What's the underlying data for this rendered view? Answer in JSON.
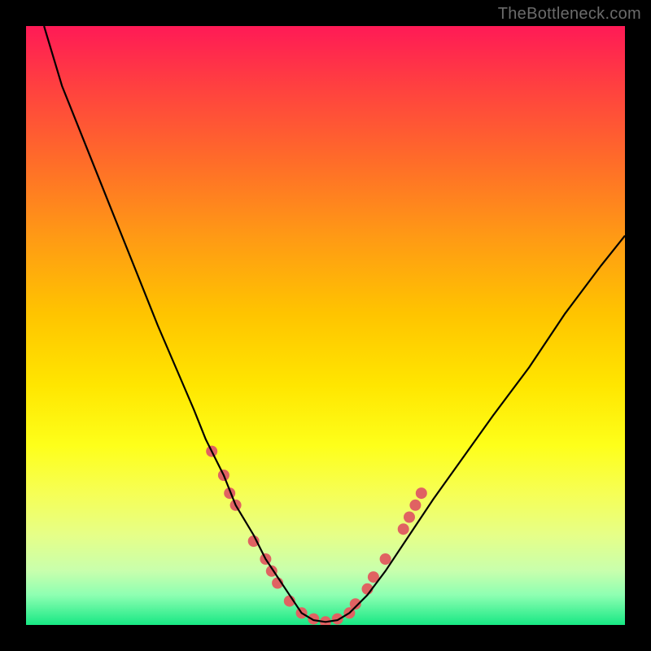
{
  "watermark": "TheBottleneck.com",
  "chart_data": {
    "type": "line",
    "title": "",
    "xlabel": "",
    "ylabel": "",
    "xlim": [
      0,
      100
    ],
    "ylim": [
      0,
      100
    ],
    "series": [
      {
        "name": "curve-left",
        "x": [
          3,
          6,
          10,
          14,
          18,
          22,
          25,
          28,
          30,
          33,
          35,
          38,
          40,
          42,
          44,
          46
        ],
        "values": [
          100,
          90,
          80,
          70,
          60,
          50,
          43,
          36,
          31,
          25,
          20,
          15,
          11,
          8,
          5,
          2
        ]
      },
      {
        "name": "curve-bottom",
        "x": [
          46,
          48,
          50,
          52,
          54
        ],
        "values": [
          2,
          0.8,
          0.5,
          0.8,
          2
        ]
      },
      {
        "name": "curve-right",
        "x": [
          54,
          57,
          60,
          64,
          68,
          73,
          78,
          84,
          90,
          96,
          100
        ],
        "values": [
          2,
          5,
          9,
          15,
          21,
          28,
          35,
          43,
          52,
          60,
          65
        ]
      }
    ],
    "markers": [
      {
        "x": 31,
        "y": 29
      },
      {
        "x": 33,
        "y": 25
      },
      {
        "x": 34,
        "y": 22
      },
      {
        "x": 35,
        "y": 20
      },
      {
        "x": 38,
        "y": 14
      },
      {
        "x": 40,
        "y": 11
      },
      {
        "x": 41,
        "y": 9
      },
      {
        "x": 42,
        "y": 7
      },
      {
        "x": 44,
        "y": 4
      },
      {
        "x": 46,
        "y": 2
      },
      {
        "x": 48,
        "y": 1
      },
      {
        "x": 50,
        "y": 0.5
      },
      {
        "x": 52,
        "y": 1
      },
      {
        "x": 54,
        "y": 2
      },
      {
        "x": 55,
        "y": 3.5
      },
      {
        "x": 57,
        "y": 6
      },
      {
        "x": 58,
        "y": 8
      },
      {
        "x": 60,
        "y": 11
      },
      {
        "x": 63,
        "y": 16
      },
      {
        "x": 64,
        "y": 18
      },
      {
        "x": 65,
        "y": 20
      },
      {
        "x": 66,
        "y": 22
      }
    ],
    "marker_color": "#e06262",
    "curve_width": 2.2,
    "marker_radius": 7
  }
}
